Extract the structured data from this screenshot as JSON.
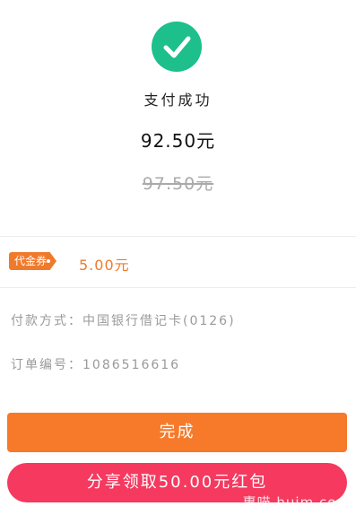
{
  "colors": {
    "success": "#1dbf8a",
    "coupon": "#f07a2c",
    "primary": "#f77a2a",
    "share": "#f5395f"
  },
  "status": {
    "icon": "check-icon",
    "text": "支付成功"
  },
  "payment": {
    "amount_paid": "92.50元",
    "amount_original": "97.50元"
  },
  "coupon": {
    "tag_label": "代金券",
    "amount": "5.00元"
  },
  "details": {
    "payment_method": "付款方式：中国银行借记卡(0126)",
    "order_number": "订单编号：1086516616"
  },
  "buttons": {
    "done_label": "完成",
    "share_label": "分享领取50.00元红包"
  },
  "watermark": "惠喵 huim.com"
}
